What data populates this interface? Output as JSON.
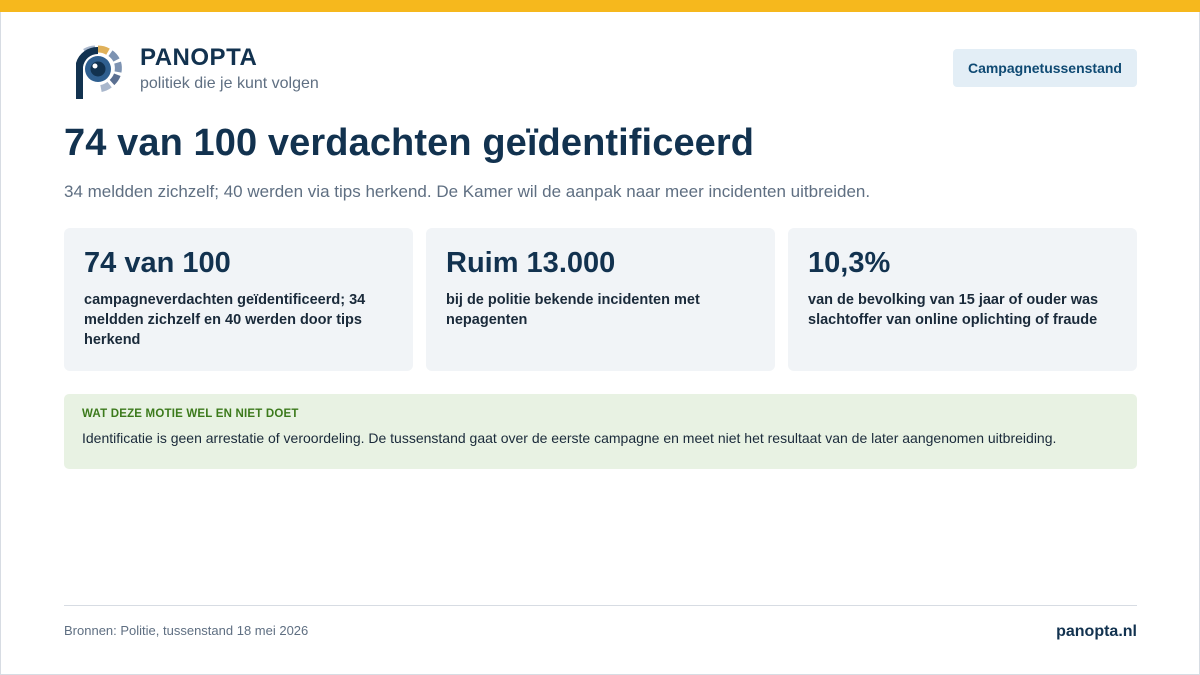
{
  "brand": {
    "name": "PANOPTA",
    "tagline": "politiek die je kunt volgen",
    "status": "Campagnetussenstand"
  },
  "headline": "74 van 100 verdachten geïdentificeerd",
  "subline": "34 meldden zichzelf; 40 werden via tips herkend. De Kamer wil de aanpak naar meer incidenten uitbreiden.",
  "stats": [
    {
      "value": "74 van 100",
      "label": "campagneverdachten geïdentificeerd; 34 meldden zichzelf en 40 werden door tips herkend"
    },
    {
      "value": "Ruim 13.000",
      "label": "bij de politie bekende incidenten met nepagenten"
    },
    {
      "value": "10,3%",
      "label": "van de bevolking van 15 jaar of ouder was slachtoffer van online oplichting of fraude"
    }
  ],
  "note": {
    "title": "WAT DEZE MOTIE WEL EN NIET DOET",
    "text": "Identificatie is geen arrestatie of veroordeling. De tussenstand gaat over de eerste campagne en meet niet het resultaat van de later aangenomen uitbreiding."
  },
  "footer": {
    "sources": "Bronnen: Politie, tussenstand 18 mei 2026",
    "site": "panopta.nl"
  },
  "icons": {
    "logo": "panopta-eye-logo"
  },
  "colors": {
    "accent_bar": "#f6b81d",
    "brand_navy": "#12324f",
    "note_green": "#3c7a1c",
    "note_bg": "#e8f2e3",
    "card_bg": "#f1f4f7"
  }
}
